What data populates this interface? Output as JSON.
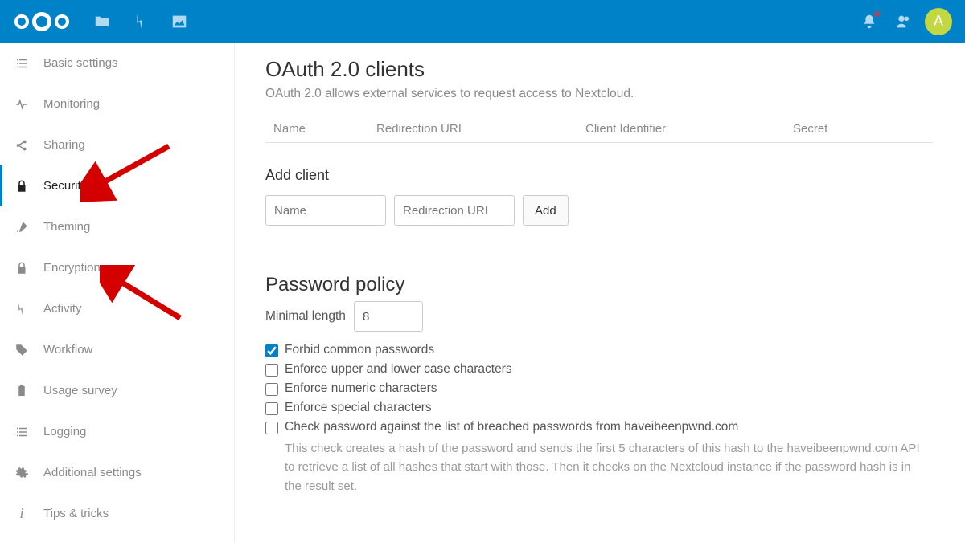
{
  "avatar_letter": "A",
  "sidebar": {
    "items": [
      {
        "label": "Basic settings"
      },
      {
        "label": "Monitoring"
      },
      {
        "label": "Sharing"
      },
      {
        "label": "Security"
      },
      {
        "label": "Theming"
      },
      {
        "label": "Encryption"
      },
      {
        "label": "Activity"
      },
      {
        "label": "Workflow"
      },
      {
        "label": "Usage survey"
      },
      {
        "label": "Logging"
      },
      {
        "label": "Additional settings"
      },
      {
        "label": "Tips & tricks"
      }
    ]
  },
  "oauth": {
    "title": "OAuth 2.0 clients",
    "subtitle": "OAuth 2.0 allows external services to request access to Nextcloud.",
    "th_name": "Name",
    "th_redir": "Redirection URI",
    "th_client": "Client Identifier",
    "th_secret": "Secret",
    "add_heading": "Add client",
    "name_ph": "Name",
    "redir_ph": "Redirection URI",
    "add_btn": "Add"
  },
  "pw": {
    "title": "Password policy",
    "minlen_label": "Minimal length",
    "minlen_value": "8",
    "forbid_common": "Forbid common passwords",
    "enforce_case": "Enforce upper and lower case characters",
    "enforce_numeric": "Enforce numeric characters",
    "enforce_special": "Enforce special characters",
    "check_pwned": "Check password against the list of breached passwords from haveibeenpwnd.com",
    "help": "This check creates a hash of the password and sends the first 5 characters of this hash to the haveibeenpwnd.com API to retrieve a list of all hashes that start with those. Then it checks on the Nextcloud instance if the password hash is in the result set."
  }
}
